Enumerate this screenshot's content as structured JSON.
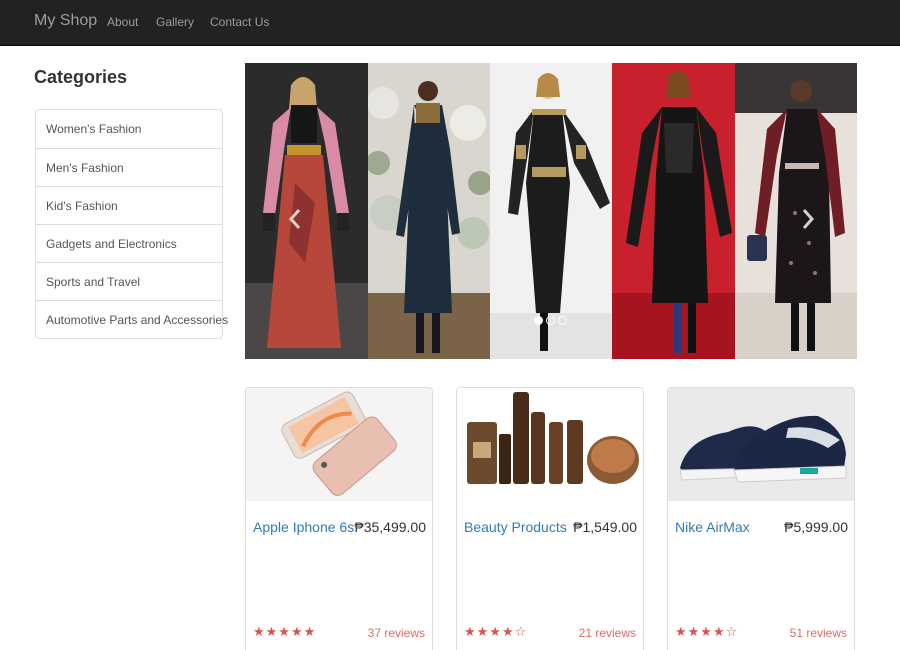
{
  "navbar": {
    "brand": "My Shop",
    "links": [
      "About",
      "Gallery",
      "Contact Us"
    ],
    "background": "#222222"
  },
  "sidebar": {
    "heading": "Categories",
    "items": [
      "Women's Fashion",
      "Men's Fashion",
      "Kid's Fashion",
      "Gadgets and Electronics",
      "Sports and Travel",
      "Automotive Parts and Accessories"
    ]
  },
  "carousel": {
    "icons": {
      "prev": "chevron-left-icon",
      "next": "chevron-right-icon"
    },
    "slide_count": 3,
    "active_slide": 1
  },
  "products": [
    {
      "name": "Apple Iphone 6s",
      "price": "₱35,499.00",
      "stars": "★★★★★",
      "rating": 5,
      "reviews": "37 reviews"
    },
    {
      "name": "Beauty Products",
      "price": "₱1,549.00",
      "stars": "★★★★☆",
      "rating": 4,
      "reviews": "21 reviews"
    },
    {
      "name": "Nike AirMax",
      "price": "₱5,999.00",
      "stars": "★★★★☆",
      "rating": 4,
      "reviews": "51 reviews"
    }
  ],
  "colors": {
    "link": "#337ab7",
    "rating": "#d9534f",
    "border": "#dddddd"
  }
}
